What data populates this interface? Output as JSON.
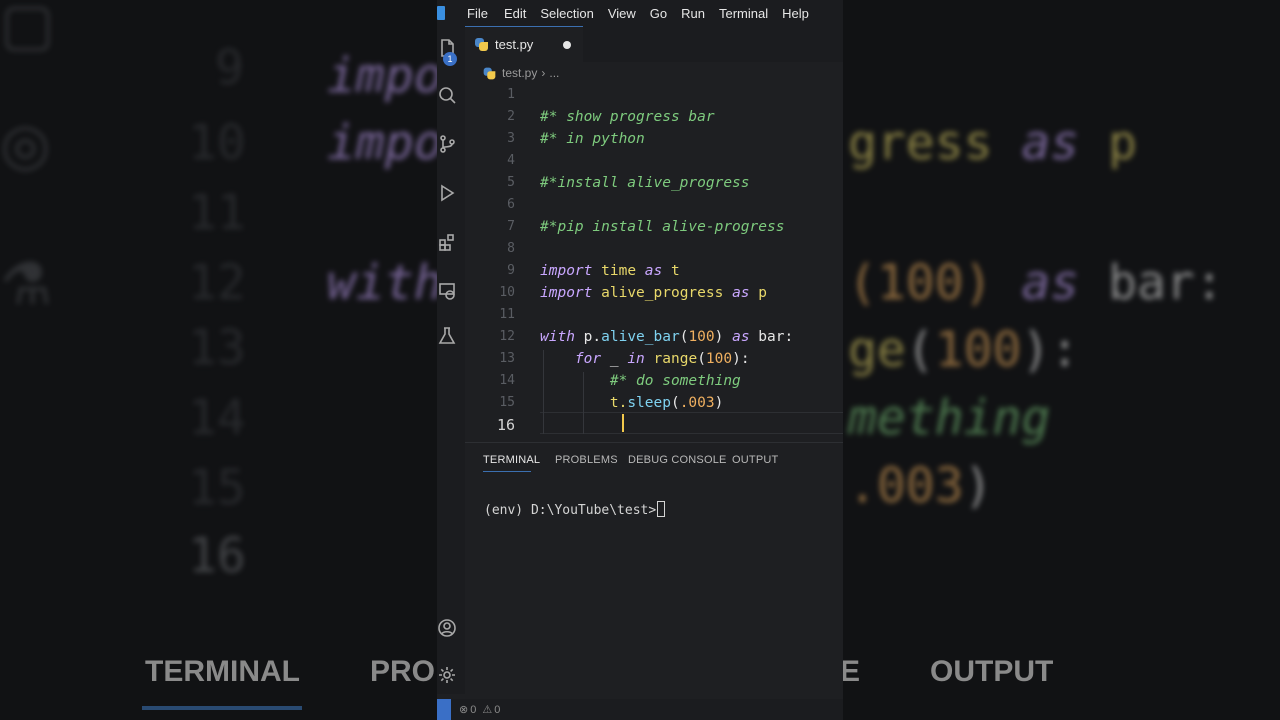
{
  "menu": [
    "File",
    "Edit",
    "Selection",
    "View",
    "Go",
    "Run",
    "Terminal",
    "Help"
  ],
  "tab": {
    "filename": "test.py"
  },
  "breadcrumb": {
    "file": "test.py",
    "more": "..."
  },
  "explorer_badge": "1",
  "code_lines": [
    {
      "n": "1",
      "tokens": []
    },
    {
      "n": "2",
      "tokens": [
        {
          "t": "#* show progress bar",
          "c": "cm"
        }
      ]
    },
    {
      "n": "3",
      "tokens": [
        {
          "t": "#* in python",
          "c": "cm"
        }
      ]
    },
    {
      "n": "4",
      "tokens": []
    },
    {
      "n": "5",
      "tokens": [
        {
          "t": "#*install alive_progress",
          "c": "cm"
        }
      ]
    },
    {
      "n": "6",
      "tokens": []
    },
    {
      "n": "7",
      "tokens": [
        {
          "t": "#*pip install alive-progress",
          "c": "cm"
        }
      ]
    },
    {
      "n": "8",
      "tokens": []
    },
    {
      "n": "9",
      "tokens": [
        {
          "t": "import",
          "c": "kw"
        },
        {
          "t": " ",
          "c": "id"
        },
        {
          "t": "time",
          "c": "mod"
        },
        {
          "t": " ",
          "c": "id"
        },
        {
          "t": "as",
          "c": "kw"
        },
        {
          "t": " t",
          "c": "mod"
        }
      ]
    },
    {
      "n": "10",
      "tokens": [
        {
          "t": "import",
          "c": "kw"
        },
        {
          "t": " ",
          "c": "id"
        },
        {
          "t": "alive_progress",
          "c": "mod"
        },
        {
          "t": " ",
          "c": "id"
        },
        {
          "t": "as",
          "c": "kw"
        },
        {
          "t": " p",
          "c": "mod"
        }
      ]
    },
    {
      "n": "11",
      "tokens": []
    },
    {
      "n": "12",
      "tokens": [
        {
          "t": "with",
          "c": "kw"
        },
        {
          "t": " p.",
          "c": "id"
        },
        {
          "t": "alive_bar",
          "c": "fn"
        },
        {
          "t": "(",
          "c": "id"
        },
        {
          "t": "100",
          "c": "nm"
        },
        {
          "t": ") ",
          "c": "id"
        },
        {
          "t": "as",
          "c": "kw"
        },
        {
          "t": " bar:",
          "c": "id"
        }
      ]
    },
    {
      "n": "13",
      "tokens": [
        {
          "t": "    ",
          "c": "id"
        },
        {
          "t": "for",
          "c": "kw"
        },
        {
          "t": " _ ",
          "c": "id"
        },
        {
          "t": "in",
          "c": "kw"
        },
        {
          "t": " ",
          "c": "id"
        },
        {
          "t": "range",
          "c": "mod"
        },
        {
          "t": "(",
          "c": "id"
        },
        {
          "t": "100",
          "c": "nm"
        },
        {
          "t": "):",
          "c": "id"
        }
      ]
    },
    {
      "n": "14",
      "tokens": [
        {
          "t": "        ",
          "c": "id"
        },
        {
          "t": "#* do something",
          "c": "cm"
        }
      ]
    },
    {
      "n": "15",
      "tokens": [
        {
          "t": "        ",
          "c": "id"
        },
        {
          "t": "t.",
          "c": "mod"
        },
        {
          "t": "sleep",
          "c": "fn"
        },
        {
          "t": "(",
          "c": "id"
        },
        {
          "t": ".003",
          "c": "nm"
        },
        {
          "t": ")",
          "c": "id"
        }
      ]
    },
    {
      "n": "16",
      "tokens": []
    }
  ],
  "panel": {
    "tabs": [
      "TERMINAL",
      "PROBLEMS",
      "DEBUG CONSOLE",
      "OUTPUT"
    ],
    "terminal_prompt": "(env) D:\\YouTube\\test>"
  },
  "status": {
    "errors": "0",
    "warnings": "0"
  },
  "colors": {
    "accent": "#3b6fb0",
    "background": "#1e1f22",
    "comment": "#7ecb7e",
    "keyword": "#c9a7ff"
  }
}
